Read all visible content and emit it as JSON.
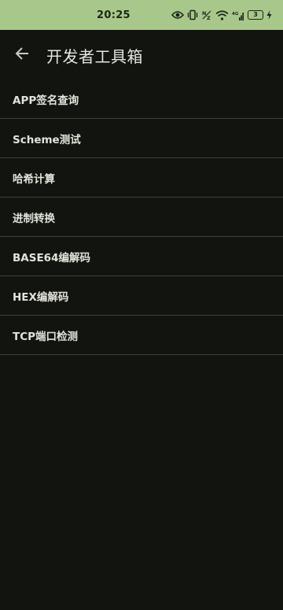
{
  "status_bar": {
    "time": "20:25",
    "battery_level": "3",
    "icons": [
      "eye-icon",
      "vibrate-icon",
      "nfc-icon",
      "wifi-icon",
      "signal-icon",
      "battery-icon",
      "charging-icon"
    ],
    "background_color": "#a7c88a"
  },
  "app_bar": {
    "back_icon": "arrow-left-icon",
    "title": "开发者工具箱"
  },
  "tools": [
    {
      "label": "APP签名查询"
    },
    {
      "label": "Scheme测试"
    },
    {
      "label": "哈希计算"
    },
    {
      "label": "进制转换"
    },
    {
      "label": "BASE64编解码"
    },
    {
      "label": "HEX编解码"
    },
    {
      "label": "TCP端口检测"
    }
  ],
  "theme": {
    "background": "#121410",
    "text": "#e2e4da",
    "divider": "#3e413b"
  }
}
